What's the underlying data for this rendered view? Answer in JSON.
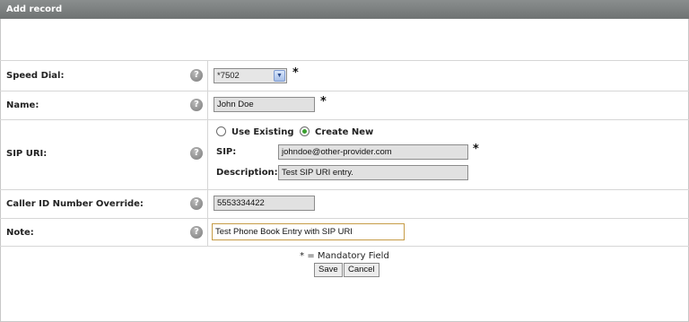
{
  "window": {
    "title": "Add record"
  },
  "help_glyph": "?",
  "required_marker": "*",
  "fields": {
    "speed_dial": {
      "label": "Speed Dial:",
      "value": "*7502"
    },
    "name": {
      "label": "Name:",
      "value": "John Doe"
    },
    "sip_uri": {
      "label": "SIP URI:",
      "option_use_existing": "Use Existing",
      "option_create_new": "Create New",
      "selected_option": "Create New",
      "sip_label": "SIP:",
      "sip_value": "johndoe@other-provider.com",
      "description_label": "Description:",
      "description_value": "Test SIP URI entry."
    },
    "caller_id": {
      "label": "Caller ID Number Override:",
      "value": "5553334422"
    },
    "note": {
      "label": "Note:",
      "value": "Test Phone Book Entry with SIP URI"
    }
  },
  "footer": {
    "mandatory_text": "* = Mandatory Field",
    "save_label": "Save",
    "cancel_label": "Cancel"
  },
  "icons": {
    "help": "question-circle-icon",
    "dropdown": "chevron-down-icon"
  }
}
